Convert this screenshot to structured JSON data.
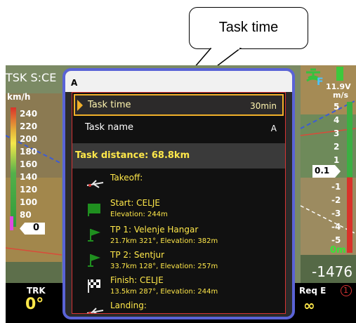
{
  "callout": {
    "text": "Task time"
  },
  "status_bar": {
    "task_label": "TSK S:CE",
    "battery_voltage": "11.9V",
    "gps_label": "F"
  },
  "speed_tape": {
    "unit": "km/h",
    "labels": [
      "240",
      "220",
      "200",
      "180",
      "160",
      "140",
      "120",
      "100",
      "80"
    ],
    "current_value": "0"
  },
  "vario": {
    "unit": "m/s",
    "labels": [
      "5",
      "4",
      "3",
      "2",
      "1",
      "0.1",
      "-1",
      "-2",
      "-3",
      "-4",
      "-5"
    ],
    "current_value": "0.1",
    "green_readout": "0m",
    "altitude": "-1476"
  },
  "bottom_bar": {
    "trk_label": "TRK",
    "trk_value": "0°",
    "req_label": "Req E",
    "req_value": "∞",
    "circle_number": "1"
  },
  "dialog": {
    "title": "A",
    "task_time_label": "Task time",
    "task_time_value": "30min",
    "task_name_label": "Task name",
    "task_name_value": "A",
    "distance_text": "Task distance: 68.8km",
    "waypoints": [
      {
        "name": "Takeoff:",
        "detail": "",
        "icon": "glider-icon"
      },
      {
        "name": "Start: CELJE",
        "detail": "Elevation: 244m",
        "icon": "start-flag-icon"
      },
      {
        "name": "TP 1: Velenje Hangar",
        "detail": "21.7km 321°, Elevation: 382m",
        "icon": "turnpoint-flag-icon"
      },
      {
        "name": "TP 2: Sentjur",
        "detail": "33.7km 128°, Elevation: 257m",
        "icon": "turnpoint-flag-icon"
      },
      {
        "name": "Finish: CELJE",
        "detail": "13.5km 287°, Elevation: 244m",
        "icon": "finish-flag-icon"
      },
      {
        "name": "Landing:",
        "detail": "",
        "icon": "glider-icon"
      }
    ]
  },
  "colors": {
    "dialog_border": "#5a63d6",
    "highlight": "#f1b02a",
    "text_yellow": "#ffe84a"
  }
}
